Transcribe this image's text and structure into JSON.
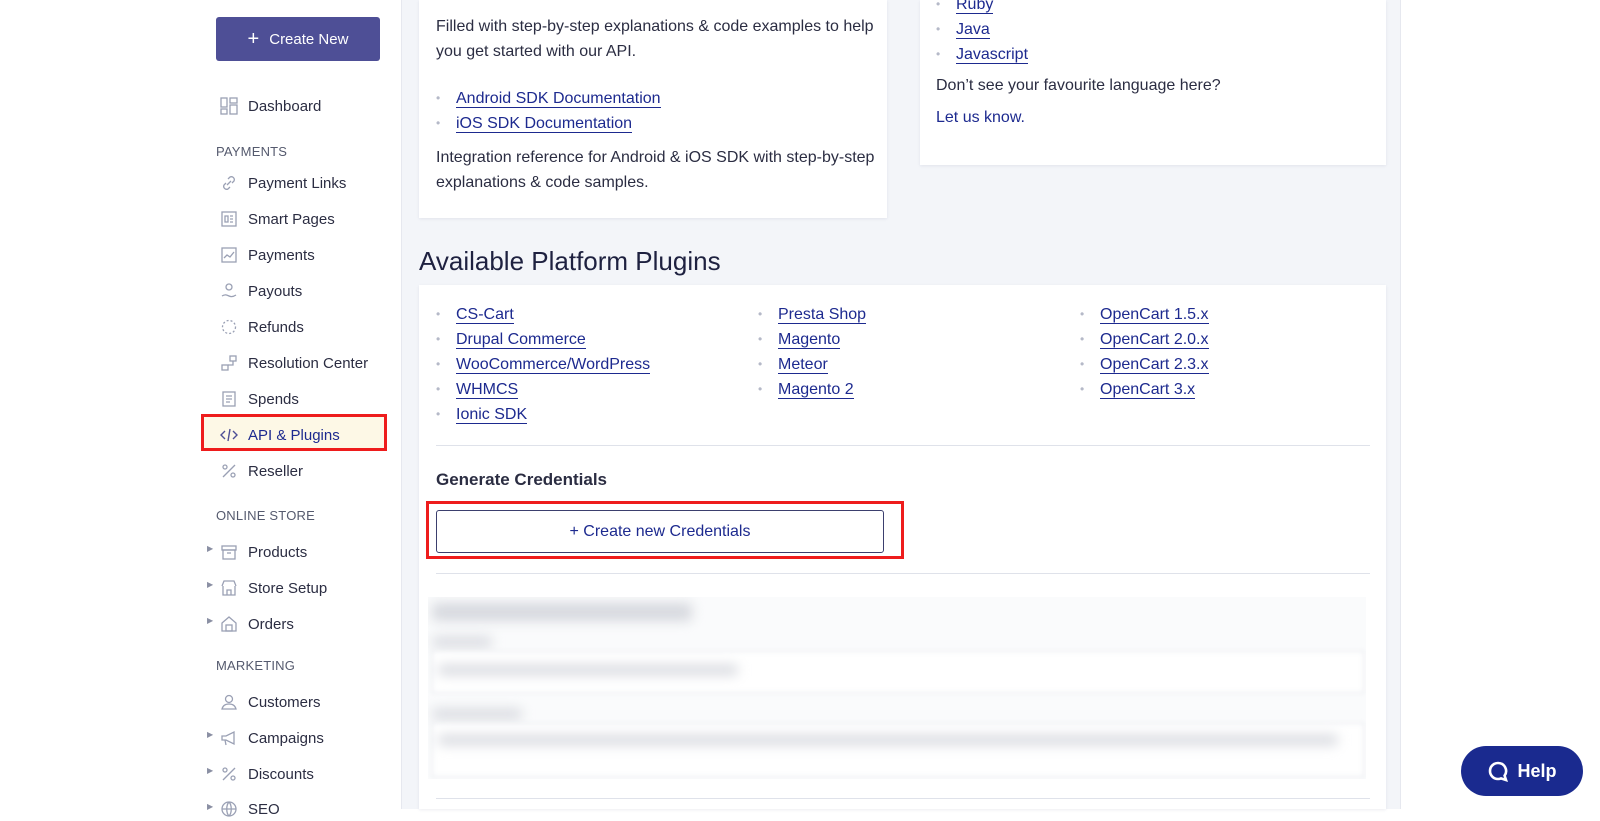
{
  "sidebar": {
    "create_label": "Create New",
    "dashboard": "Dashboard",
    "sections": {
      "payments": "PAYMENTS",
      "online_store": "ONLINE STORE",
      "marketing": "MARKETING"
    },
    "payments_items": [
      "Payment Links",
      "Smart Pages",
      "Payments",
      "Payouts",
      "Refunds",
      "Resolution Center",
      "Spends",
      "API & Plugins",
      "Reseller"
    ],
    "store_items": [
      "Products",
      "Store Setup",
      "Orders"
    ],
    "marketing_items": [
      "Customers",
      "Campaigns",
      "Discounts",
      "SEO"
    ]
  },
  "docs_card": {
    "intro": "Filled with step-by-step explanations & code examples to help you get started with our API.",
    "links": [
      "Android SDK Documentation",
      "iOS SDK Documentation"
    ],
    "outro": "Integration reference for Android & iOS SDK with step-by-step explanations & code samples."
  },
  "lang_card": {
    "languages": [
      "Ruby",
      "Java",
      "Javascript"
    ],
    "prompt": "Don’t see your favourite language here?",
    "cta": "Let us know."
  },
  "plugins": {
    "heading": "Available Platform Plugins",
    "col1": [
      "CS-Cart",
      "Drupal Commerce",
      "WooCommerce/WordPress",
      "WHMCS",
      "Ionic SDK"
    ],
    "col2": [
      "Presta Shop",
      "Magento",
      "Meteor",
      "Magento 2"
    ],
    "col3": [
      "OpenCart 1.5.x",
      "OpenCart 2.0.x",
      "OpenCart 2.3.x",
      "OpenCart 3.x"
    ]
  },
  "credentials": {
    "heading": "Generate Credentials",
    "button": "+ Create new Credentials"
  },
  "help": {
    "label": "Help"
  },
  "colors": {
    "primary": "#4e4f96",
    "link": "#1d2a8f",
    "highlight": "#ee1c1c",
    "help": "#1a2a8f"
  }
}
